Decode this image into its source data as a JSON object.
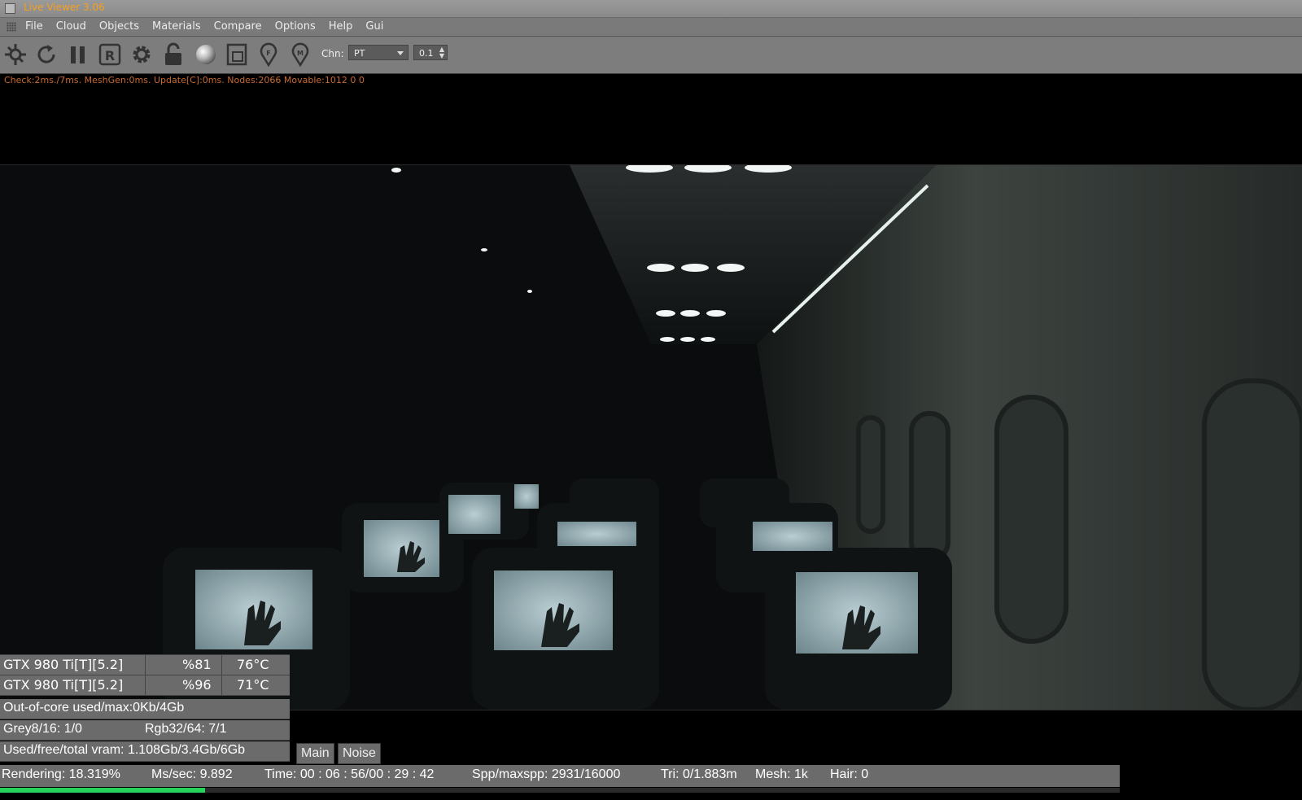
{
  "window": {
    "title": "Live Viewer 3.06"
  },
  "menu": [
    "File",
    "Cloud",
    "Objects",
    "Materials",
    "Compare",
    "Options",
    "Help",
    "Gui"
  ],
  "toolbar": {
    "buttons": [
      {
        "icon": "recenter-icon"
      },
      {
        "icon": "reset-icon"
      },
      {
        "icon": "pause-icon"
      },
      {
        "icon": "restart-icon"
      },
      {
        "icon": "settings-gear-icon"
      },
      {
        "icon": "lock-icon"
      },
      {
        "icon": "sphere-icon"
      },
      {
        "icon": "region-icon"
      },
      {
        "icon": "focus-picker-icon"
      },
      {
        "icon": "material-picker-icon"
      }
    ],
    "channel_label": "Chn:",
    "channel_value": "PT",
    "step_value": "0.1"
  },
  "stats_line": "Check:2ms./7ms. MeshGen:0ms. Update[C]:0ms. Nodes:2066 Movable:1012  0 0",
  "gpus": [
    {
      "name": "GTX 980 Ti[T][5.2]",
      "usage": "%81",
      "temp": "76°C"
    },
    {
      "name": "GTX 980 Ti[T][5.2]",
      "usage": "%96",
      "temp": "71°C"
    }
  ],
  "out_of_core": {
    "label": "Out-of-core used/max:",
    "value": "0Kb/4Gb"
  },
  "textures": {
    "grey_label": "Grey8/16: ",
    "grey_value": "1/0",
    "rgb_label": "Rgb32/64: ",
    "rgb_value": "7/1"
  },
  "vram": {
    "label": "Used/free/total vram: ",
    "value": "1.108Gb/3.4Gb/6Gb"
  },
  "tabs": [
    "Main",
    "Noise"
  ],
  "status": {
    "rendering_label": "Rendering: ",
    "rendering_value": "18.319%",
    "mssec_label": "Ms/sec: ",
    "mssec_value": "9.892",
    "time_label": "Time: ",
    "time_value": "00 : 06 : 56/00 : 29 : 42",
    "spp_label": "Spp/maxspp: ",
    "spp_value": "2931/16000",
    "tri_label": "Tri: ",
    "tri_value": "0/1.883m",
    "mesh_label": "Mesh: ",
    "mesh_value": "1k",
    "hair_label": "Hair: ",
    "hair_value": "0"
  },
  "progress": 0.18319,
  "colors": {
    "title": "#f4a020",
    "value": "#56e0b8",
    "progress": "#27d35a",
    "stats": "#c76a30"
  }
}
